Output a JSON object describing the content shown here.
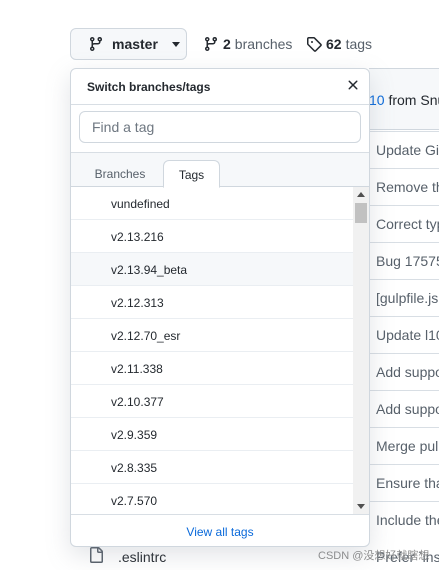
{
  "repo_nav": {
    "branch_name": "master",
    "branches_count": "2",
    "branches_label": "branches",
    "tags_count": "62",
    "tags_label": "tags"
  },
  "commit_bar": {
    "link_fragment": "10",
    "text_fragment": "from Snu"
  },
  "background_rows": [
    "Update Gi",
    "Remove th",
    "Correct typ",
    "Bug 17575",
    "[gulpfile.js",
    "Update l10",
    "Add suppo",
    "Add suppo",
    "Merge pul",
    "Ensure tha",
    "Include the"
  ],
  "last_file": {
    "name": ".eslintrc",
    "right_text": "Prefer `ins"
  },
  "watermark": "CSDN @没想好就瞎想",
  "dropdown": {
    "title": "Switch branches/tags",
    "search_placeholder": "Find a tag",
    "tabs": [
      "Branches",
      "Tags"
    ],
    "active_tab": "Tags",
    "items": [
      "vundefined",
      "v2.13.216",
      "v2.13.94_beta",
      "v2.12.313",
      "v2.12.70_esr",
      "v2.11.338",
      "v2.10.377",
      "v2.9.359",
      "v2.8.335",
      "v2.7.570"
    ],
    "hovered_item": "v2.13.94_beta",
    "footer_link": "View all tags"
  }
}
